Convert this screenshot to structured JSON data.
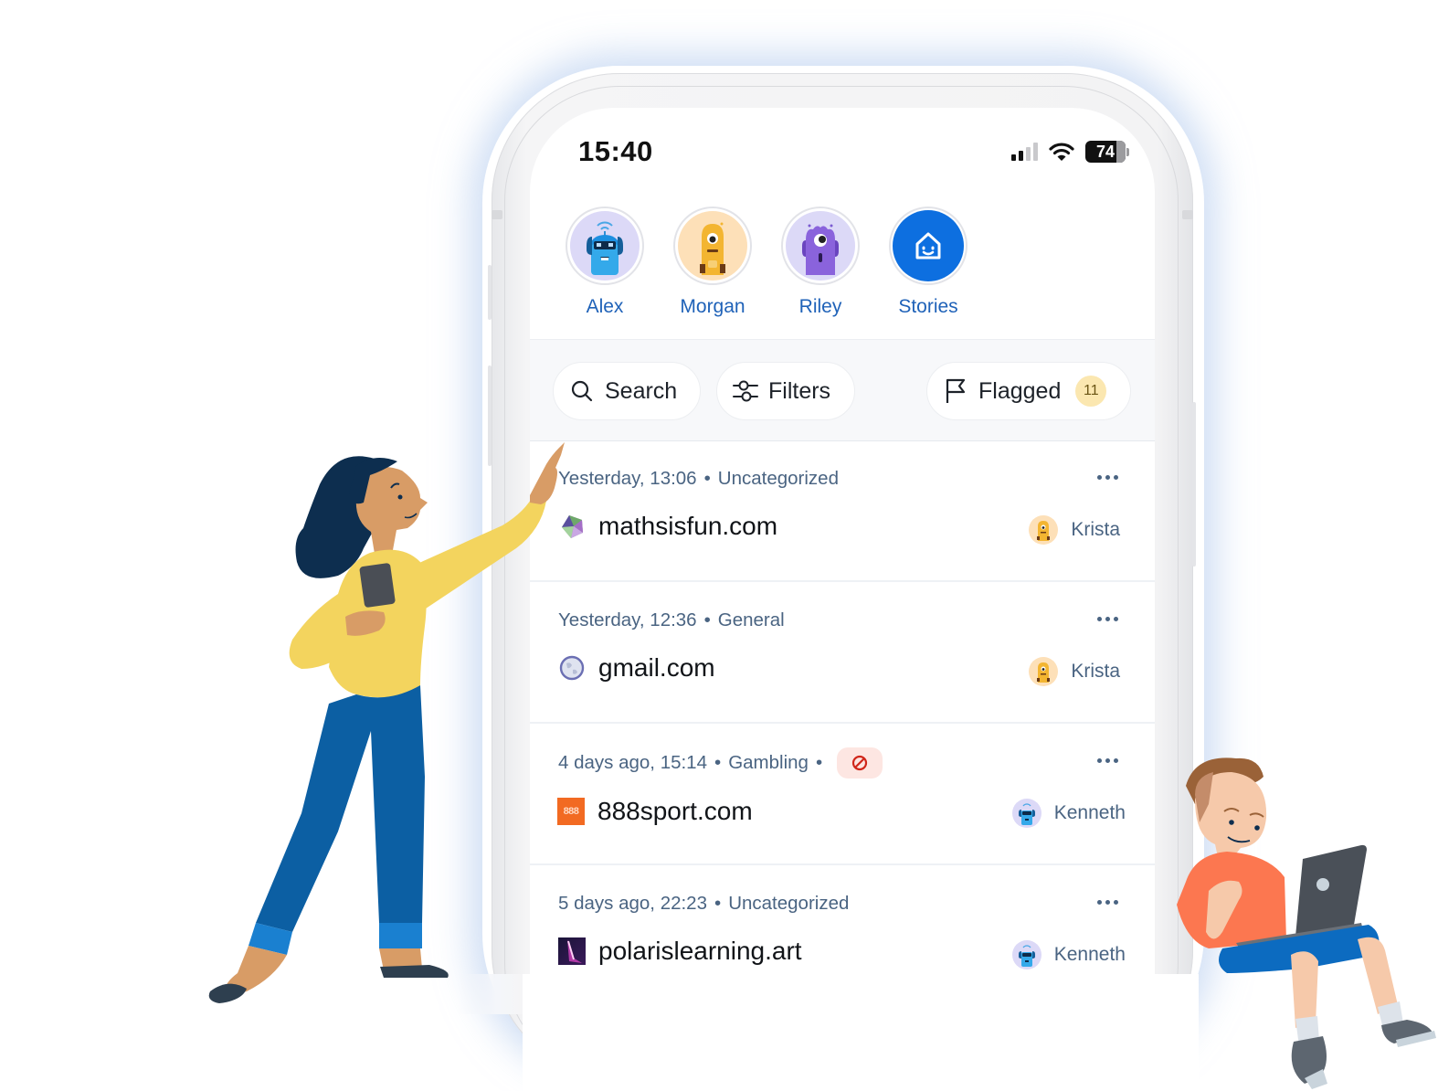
{
  "status_bar": {
    "time": "15:40",
    "battery": "74",
    "icons": [
      "cellular-signal-icon",
      "wifi-icon",
      "battery-icon"
    ]
  },
  "profiles": [
    {
      "name": "Alex",
      "avatar": "blue-robot-avatar",
      "bg": "#dcd9f7"
    },
    {
      "name": "Morgan",
      "avatar": "yellow-monster-avatar",
      "bg": "#fde0b8"
    },
    {
      "name": "Riley",
      "avatar": "purple-monster-avatar",
      "bg": "#dcd9f7"
    },
    {
      "name": "Stories",
      "avatar": "home-smile-icon",
      "bg": "#0d6fe0"
    }
  ],
  "toolbar": {
    "search_label": "Search",
    "filters_label": "Filters",
    "flagged_label": "Flagged",
    "flagged_count": "11"
  },
  "activity": [
    {
      "time": "Yesterday, 13:06",
      "separator": "•",
      "category": "Uncategorized",
      "domain": "mathsisfun.com",
      "favicon": "mathsisfun-gem-favicon",
      "user": "Krista",
      "user_avatar": "yellow-monster-avatar",
      "blocked": false
    },
    {
      "time": "Yesterday, 12:36",
      "separator": "•",
      "category": "General",
      "domain": "gmail.com",
      "favicon": "globe-favicon",
      "user": "Krista",
      "user_avatar": "yellow-monster-avatar",
      "blocked": false
    },
    {
      "time": "4 days ago, 15:14",
      "separator": "•",
      "category": "Gambling",
      "trailing_separator": "•",
      "domain": "888sport.com",
      "favicon": "888-favicon",
      "favicon_text": "888",
      "user": "Kenneth",
      "user_avatar": "blue-robot-avatar",
      "blocked": true
    },
    {
      "time": "5 days ago, 22:23",
      "separator": "•",
      "category": "Uncategorized",
      "domain": "polarislearning.art",
      "favicon": "polaris-favicon",
      "user": "Kenneth",
      "user_avatar": "blue-robot-avatar",
      "blocked": false
    }
  ],
  "colors": {
    "accent": "#0d6fe0",
    "profile_name": "#1f62b8",
    "meta_text": "#4a6482",
    "badge_bg": "#fbe7b0",
    "blocked_bg": "#fde6e2",
    "blocked_icon": "#d0261a"
  },
  "illustrations": [
    "woman-pointing-illustration",
    "boy-with-laptop-illustration"
  ]
}
